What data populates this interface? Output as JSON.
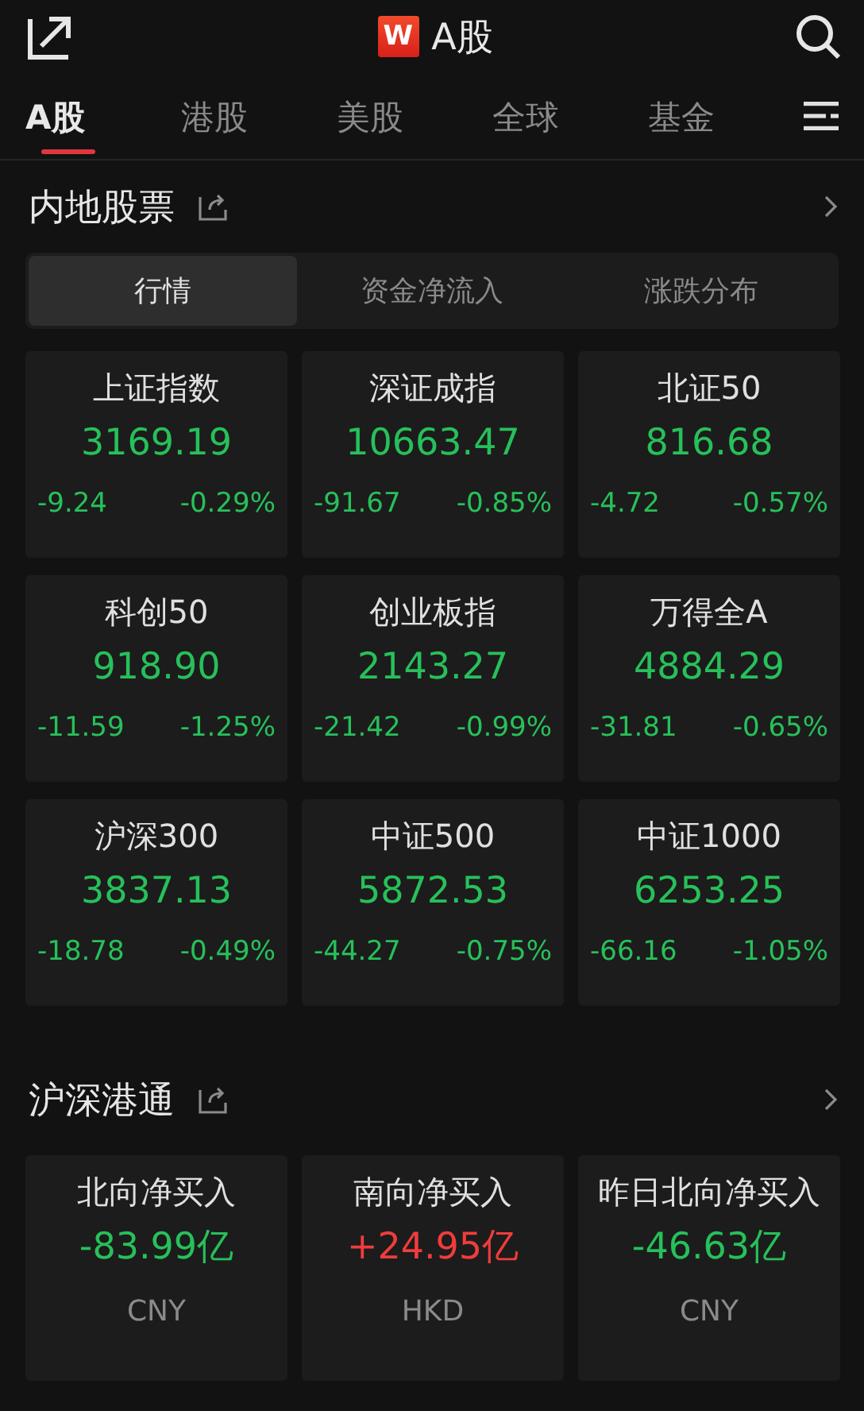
{
  "header": {
    "logo": "W",
    "title": "A股"
  },
  "tabs": [
    {
      "label": "A股",
      "selected": true
    },
    {
      "label": "港股",
      "selected": false
    },
    {
      "label": "美股",
      "selected": false
    },
    {
      "label": "全球",
      "selected": false
    },
    {
      "label": "基金",
      "selected": false
    }
  ],
  "sections": [
    {
      "title": "内地股票",
      "segments": [
        {
          "label": "行情",
          "selected": true
        },
        {
          "label": "资金净流入",
          "selected": false
        },
        {
          "label": "涨跌分布",
          "selected": false
        }
      ],
      "cards": [
        {
          "kind": "index",
          "name": "上证指数",
          "value": "3169.19",
          "change": "-9.24",
          "percent": "-0.29%",
          "color": "#27c05a"
        },
        {
          "kind": "index",
          "name": "深证成指",
          "value": "10663.47",
          "change": "-91.67",
          "percent": "-0.85%",
          "color": "#27c05a"
        },
        {
          "kind": "index",
          "name": "北证50",
          "value": "816.68",
          "change": "-4.72",
          "percent": "-0.57%",
          "color": "#27c05a"
        },
        {
          "kind": "index",
          "name": "科创50",
          "value": "918.90",
          "change": "-11.59",
          "percent": "-1.25%",
          "color": "#27c05a"
        },
        {
          "kind": "index",
          "name": "创业板指",
          "value": "2143.27",
          "change": "-21.42",
          "percent": "-0.99%",
          "color": "#27c05a"
        },
        {
          "kind": "index",
          "name": "万得全A",
          "value": "4884.29",
          "change": "-31.81",
          "percent": "-0.65%",
          "color": "#27c05a"
        },
        {
          "kind": "index",
          "name": "沪深300",
          "value": "3837.13",
          "change": "-18.78",
          "percent": "-0.49%",
          "color": "#27c05a"
        },
        {
          "kind": "index",
          "name": "中证500",
          "value": "5872.53",
          "change": "-44.27",
          "percent": "-0.75%",
          "color": "#27c05a"
        },
        {
          "kind": "index",
          "name": "中证1000",
          "value": "6253.25",
          "change": "-66.16",
          "percent": "-1.05%",
          "color": "#27c05a"
        }
      ]
    },
    {
      "title": "沪深港通",
      "cards": [
        {
          "kind": "flow",
          "name": "北向净买入",
          "value": "-83.99亿",
          "currency": "CNY",
          "color": "#27c05a"
        },
        {
          "kind": "flow",
          "name": "南向净买入",
          "value": "+24.95亿",
          "currency": "HKD",
          "color": "#f03c3c"
        },
        {
          "kind": "flow",
          "name": "昨日北向净买入",
          "value": "-46.63亿",
          "currency": "CNY",
          "color": "#27c05a"
        }
      ]
    }
  ]
}
